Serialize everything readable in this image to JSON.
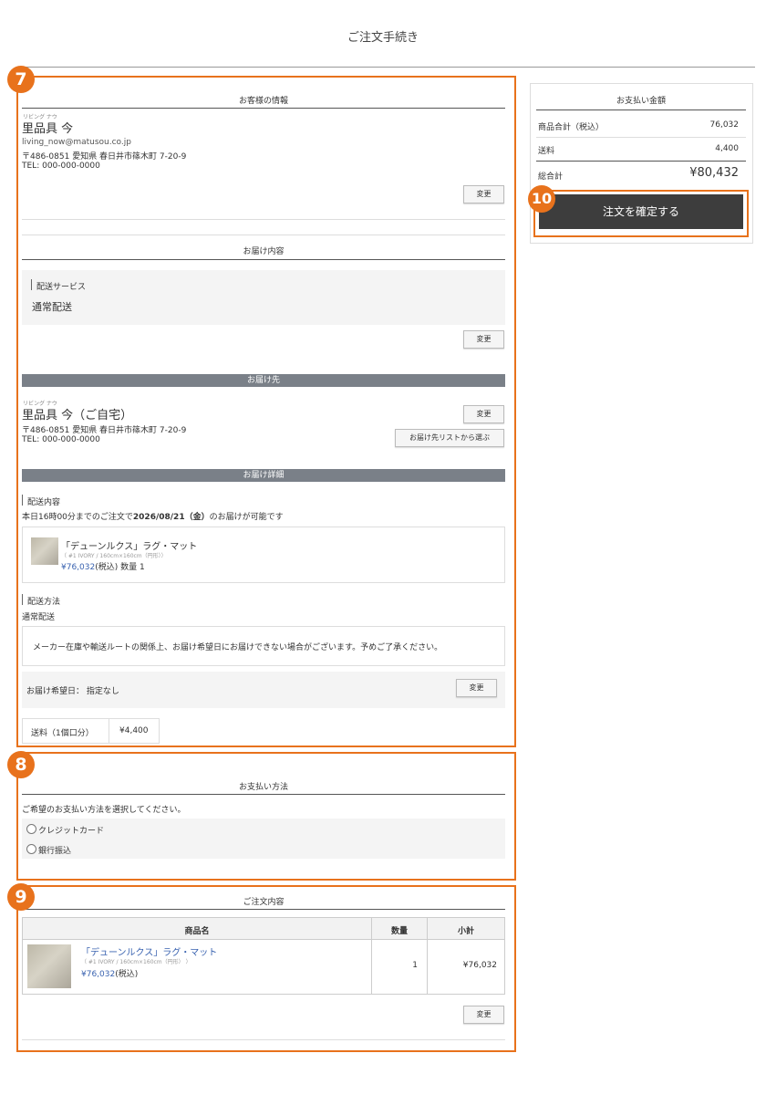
{
  "page": {
    "title": "ご注文手続き"
  },
  "badges": {
    "b7": "7",
    "b8": "8",
    "b9": "9",
    "b10": "10"
  },
  "customer": {
    "heading": "お客様の情報",
    "ruby": "リビング ナウ",
    "name": "里品具 今",
    "email": "living_now@matusou.co.jp",
    "address": "〒486-0851 愛知県 春日井市篠木町 7-20-9",
    "tel": "TEL: 000-000-0000",
    "change_label": "変更"
  },
  "delivery_content": {
    "heading": "お届け内容",
    "service_label": "配送サービス",
    "service_value": "通常配送",
    "change_label": "変更"
  },
  "destination": {
    "band": "お届け先",
    "ruby": "リビング ナウ",
    "name": "里品具 今（ご自宅）",
    "address": "〒486-0851 愛知県 春日井市篠木町 7-20-9",
    "tel": "TEL: 000-000-0000",
    "change_label": "変更",
    "list_button": "お届け先リストから選ぶ"
  },
  "delivery_detail": {
    "band": "お届け詳細",
    "content_label": "配送内容",
    "notice_pre": "本日16時00分までのご注文で",
    "notice_date": "2026/08/21（金）",
    "notice_post": "のお届けが可能です",
    "item_name": "「デューンルクス」ラグ・マット",
    "item_spec": "（ #1 IVORY / 160cm×160cm（円形））",
    "item_price": "¥76,032",
    "item_tax": "(税込)",
    "item_qty": "数量 1",
    "method_label": "配送方法",
    "method_value": "通常配送",
    "method_notice": "メーカー在庫や輸送ルートの関係上、お届け希望日にお届けできない場合がございます。予めご了承ください。",
    "wish_date": "お届け希望日：  指定なし",
    "change_label": "変更",
    "fee_label": "送料（1個口分）",
    "fee_value": "¥4,400"
  },
  "payment": {
    "heading": "お支払い方法",
    "prompt": "ご希望のお支払い方法を選択してください。",
    "options": [
      "クレジットカード",
      "銀行振込"
    ]
  },
  "order": {
    "heading": "ご注文内容",
    "columns": [
      "商品名",
      "数量",
      "小計"
    ],
    "row": {
      "name": "「デューンルクス」ラグ・マット",
      "spec": "（ #1 IVORY / 160cm×160cm（円形） ）",
      "price": "¥76,032",
      "tax": "(税込)",
      "qty": "1",
      "subtotal": "¥76,032"
    },
    "change_label": "変更"
  },
  "summary": {
    "heading": "お支払い金額",
    "rows": [
      {
        "label": "商品合計（税込）",
        "value": "76,032"
      },
      {
        "label": "送料",
        "value": "4,400"
      }
    ],
    "total_label": "総合計",
    "total_value": "¥80,432",
    "confirm_label": "注文を確定する"
  },
  "colors": {
    "accent": "#e8721c",
    "band": "#7a8088",
    "confirm": "#3d3d3d",
    "link": "#3a63b0"
  }
}
